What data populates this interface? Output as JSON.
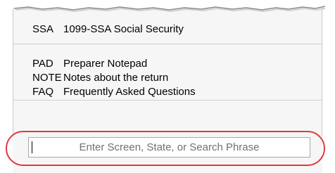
{
  "form_list": {
    "items": [
      {
        "code": "SSA",
        "description": "1099-SSA Social Security"
      },
      {
        "code": "PAD",
        "description": "Preparer Notepad"
      },
      {
        "code": "NOTE",
        "description": "Notes about the return"
      },
      {
        "code": "FAQ",
        "description": "Frequently Asked Questions"
      }
    ]
  },
  "search": {
    "placeholder": "Enter Screen, State, or Search Phrase",
    "value": ""
  },
  "colors": {
    "highlight": "#e0393f",
    "panel_background": "#f6f6f6"
  }
}
